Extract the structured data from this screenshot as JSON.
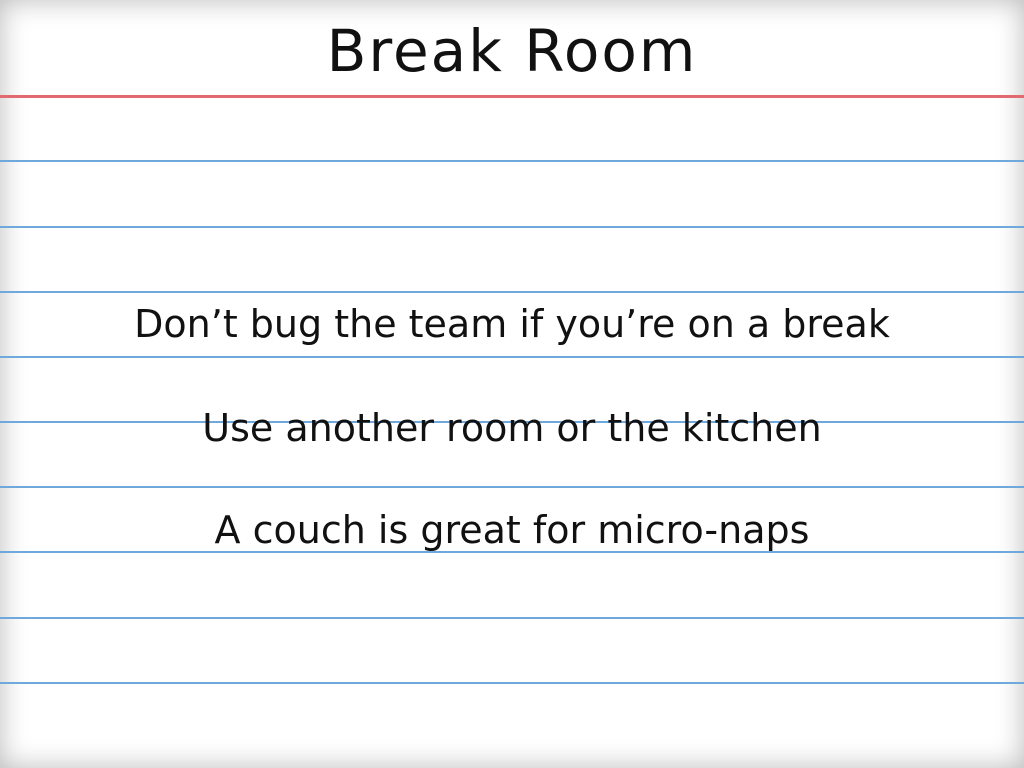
{
  "card": {
    "title": "Break Room",
    "lines": [
      "Don’t bug the team if you’re on a break",
      "Use another room or the kitchen",
      "A couch is great for micro-naps"
    ]
  },
  "colors": {
    "background": "#ffffff",
    "text": "#111111",
    "margin_line": "#e06a6f",
    "rule_line": "#6fa8dc"
  }
}
